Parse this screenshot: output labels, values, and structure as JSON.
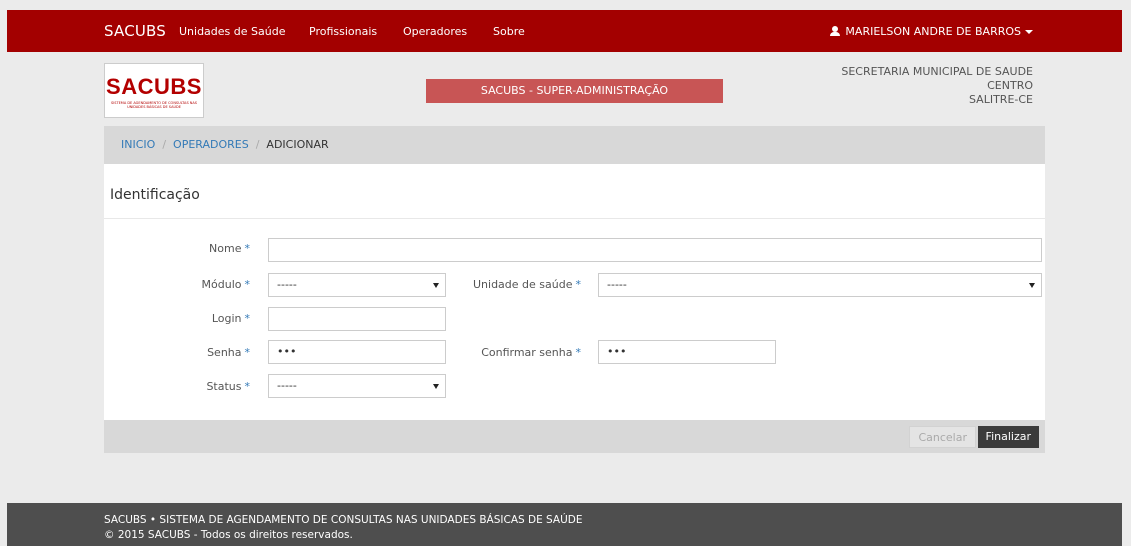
{
  "navbar": {
    "brand": "SACUBS",
    "links": [
      "Unidades de Saúde",
      "Profissionais",
      "Operadores",
      "Sobre"
    ],
    "user": "MARIELSON ANDRE DE BARROS"
  },
  "header": {
    "logo_text": "SACUBS",
    "logo_subtext": "SISTEMA DE AGENDAMENTO DE CONSULTAS NAS UNIDADES BÁSICAS DE SAÚDE",
    "admin_banner": "SACUBS - SUPER-ADMINISTRAÇÃO",
    "secretaria": [
      "SECRETARIA MUNICIPAL DE SAUDE",
      "CENTRO",
      "SALITRE-CE"
    ]
  },
  "breadcrumb": {
    "items": [
      "INICIO",
      "OPERADORES"
    ],
    "separator": "/",
    "current": "ADICIONAR"
  },
  "form": {
    "title": "Identificação",
    "required_marker": "*",
    "nome_label": "Nome",
    "nome_value": "",
    "modulo_label": "Módulo",
    "modulo_value": "-----",
    "unidade_label": "Unidade de saúde",
    "unidade_value": "-----",
    "login_label": "Login",
    "login_value": "",
    "senha_label": "Senha",
    "senha_value": "•••",
    "confirmar_label": "Confirmar senha",
    "confirmar_value": "•••",
    "status_label": "Status",
    "status_value": "-----"
  },
  "actions": {
    "cancel_label": "Cancelar",
    "finish_label": "Finalizar"
  },
  "footer": {
    "line1": "SACUBS • SISTEMA DE AGENDAMENTO DE CONSULTAS NAS UNIDADES BÁSICAS DE SAÚDE",
    "line2": "© 2015 SACUBS - Todos os direitos reservados."
  },
  "colors": {
    "navbar": "#a30000",
    "banner": "#c85555",
    "link": "#337ab7",
    "footer": "#4e4e4e"
  }
}
